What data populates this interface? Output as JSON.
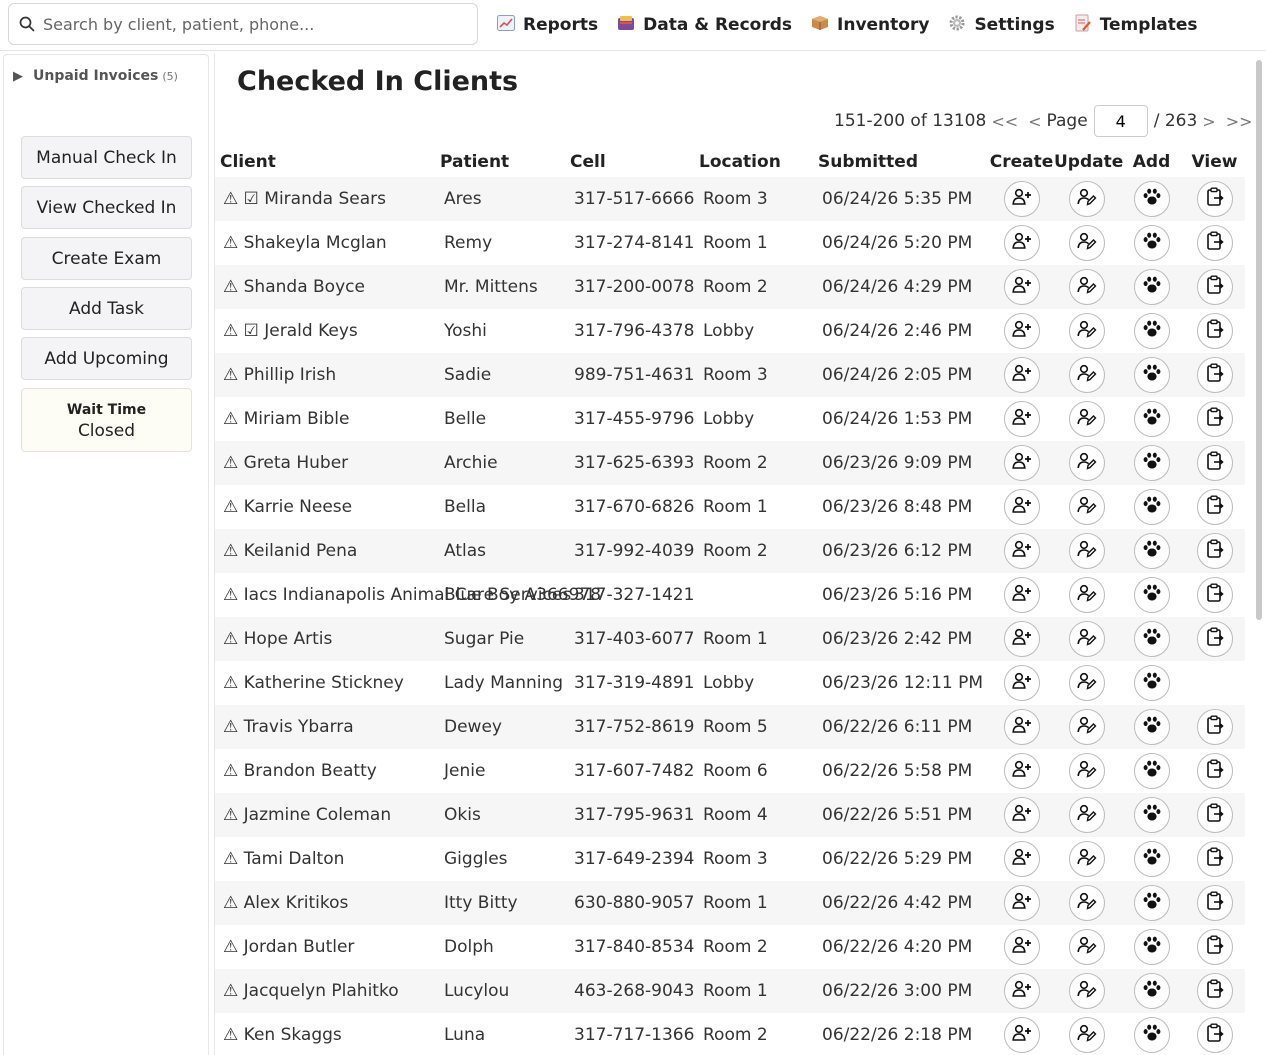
{
  "search": {
    "placeholder": "Search by client, patient, phone..."
  },
  "nav": [
    {
      "label": "Reports",
      "icon": "chart-icon"
    },
    {
      "label": "Data & Records",
      "icon": "database-icon"
    },
    {
      "label": "Inventory",
      "icon": "package-icon"
    },
    {
      "label": "Settings",
      "icon": "gear-icon"
    },
    {
      "label": "Templates",
      "icon": "document-icon"
    }
  ],
  "sidebar": {
    "unpaid_label": "Unpaid Invoices",
    "unpaid_count": "(5)",
    "buttons": [
      "Manual Check In",
      "View Checked In",
      "Create Exam",
      "Add Task",
      "Add Upcoming"
    ],
    "wait_title": "Wait Time",
    "wait_status": "Closed"
  },
  "main": {
    "title": "Checked In Clients",
    "pager": {
      "range": "151-200 of 13108",
      "first": "<<",
      "prev": "<",
      "page_label": "Page",
      "page": "4",
      "total": "/ 263",
      "next": ">",
      "last": ">>"
    },
    "columns": [
      "Client",
      "Patient",
      "Cell",
      "Location",
      "Submitted",
      "Create",
      "Update",
      "Add",
      "View"
    ],
    "rows": [
      {
        "client": "⚠ ☑ Miranda Sears",
        "patient": "Ares",
        "cell": "317-517-6666",
        "location": "Room 3",
        "submitted": "06/24/26 5:35 PM",
        "view": true
      },
      {
        "client": "⚠ Shakeyla Mcglan",
        "patient": "Remy",
        "cell": "317-274-8141",
        "location": "Room 1",
        "submitted": "06/24/26 5:20 PM",
        "view": true
      },
      {
        "client": "⚠ Shanda Boyce",
        "patient": "Mr. Mittens",
        "cell": "317-200-0078",
        "location": "Room 2",
        "submitted": "06/24/26 4:29 PM",
        "view": true
      },
      {
        "client": "⚠ ☑ Jerald Keys",
        "patient": "Yoshi",
        "cell": "317-796-4378",
        "location": "Lobby",
        "submitted": "06/24/26 2:46 PM",
        "view": true
      },
      {
        "client": "⚠ Phillip Irish",
        "patient": "Sadie",
        "cell": "989-751-4631",
        "location": "Room 3",
        "submitted": "06/24/26 2:05 PM",
        "view": true
      },
      {
        "client": "⚠ Miriam Bible",
        "patient": "Belle",
        "cell": "317-455-9796",
        "location": "Lobby",
        "submitted": "06/24/26 1:53 PM",
        "view": true
      },
      {
        "client": "⚠ Greta Huber",
        "patient": "Archie",
        "cell": "317-625-6393",
        "location": "Room 2",
        "submitted": "06/23/26 9:09 PM",
        "view": true
      },
      {
        "client": "⚠ Karrie Neese",
        "patient": "Bella",
        "cell": "317-670-6826",
        "location": "Room 1",
        "submitted": "06/23/26 8:48 PM",
        "view": true
      },
      {
        "client": "⚠ Keilanid Pena",
        "patient": "Atlas",
        "cell": "317-992-4039",
        "location": "Room 2",
        "submitted": "06/23/26 6:12 PM",
        "view": true
      },
      {
        "client": "⚠ Iacs Indianapolis Animal Care Services",
        "patient": "Blue Boy A366978",
        "cell": "317-327-1421",
        "location": "",
        "submitted": "06/23/26 5:16 PM",
        "view": true
      },
      {
        "client": "⚠ Hope Artis",
        "patient": "Sugar Pie",
        "cell": "317-403-6077",
        "location": "Room 1",
        "submitted": "06/23/26 2:42 PM",
        "view": true
      },
      {
        "client": "⚠ Katherine Stickney",
        "patient": "Lady Manning",
        "cell": "317-319-4891",
        "location": "Lobby",
        "submitted": "06/23/26 12:11 PM",
        "view": false
      },
      {
        "client": "⚠ Travis Ybarra",
        "patient": "Dewey",
        "cell": "317-752-8619",
        "location": "Room 5",
        "submitted": "06/22/26 6:11 PM",
        "view": true
      },
      {
        "client": "⚠ Brandon Beatty",
        "patient": "Jenie",
        "cell": "317-607-7482",
        "location": "Room 6",
        "submitted": "06/22/26 5:58 PM",
        "view": true
      },
      {
        "client": "⚠ Jazmine Coleman",
        "patient": "Okis",
        "cell": "317-795-9631",
        "location": "Room 4",
        "submitted": "06/22/26 5:51 PM",
        "view": true
      },
      {
        "client": "⚠ Tami Dalton",
        "patient": "Giggles",
        "cell": "317-649-2394",
        "location": "Room 3",
        "submitted": "06/22/26 5:29 PM",
        "view": true
      },
      {
        "client": "⚠ Alex Kritikos",
        "patient": "Itty Bitty",
        "cell": "630-880-9057",
        "location": "Room 1",
        "submitted": "06/22/26 4:42 PM",
        "view": true
      },
      {
        "client": "⚠ Jordan Butler",
        "patient": "Dolph",
        "cell": "317-840-8534",
        "location": "Room 2",
        "submitted": "06/22/26 4:20 PM",
        "view": true
      },
      {
        "client": "⚠ Jacquelyn Plahitko",
        "patient": "Lucylou",
        "cell": "463-268-9043",
        "location": "Room 1",
        "submitted": "06/22/26 3:00 PM",
        "view": true
      },
      {
        "client": "⚠ Ken Skaggs",
        "patient": "Luna",
        "cell": "317-717-1366",
        "location": "Room 2",
        "submitted": "06/22/26 2:18 PM",
        "view": true
      }
    ]
  }
}
